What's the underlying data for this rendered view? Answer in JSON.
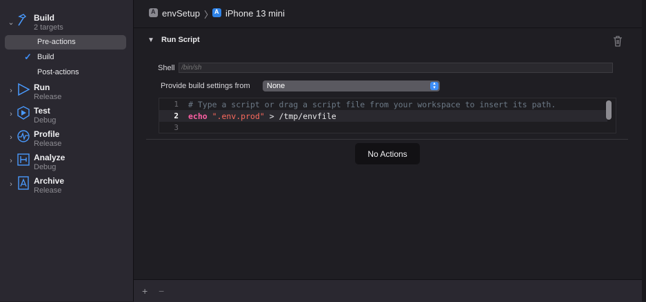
{
  "sidebar": {
    "schemes": [
      {
        "title": "Build",
        "subtitle": "2 targets",
        "icon": "hammer-icon",
        "expanded": true
      },
      {
        "title": "Run",
        "subtitle": "Release",
        "icon": "play-icon"
      },
      {
        "title": "Test",
        "subtitle": "Debug",
        "icon": "test-icon"
      },
      {
        "title": "Profile",
        "subtitle": "Release",
        "icon": "profile-gauge-icon"
      },
      {
        "title": "Analyze",
        "subtitle": "Debug",
        "icon": "analyze-icon"
      },
      {
        "title": "Archive",
        "subtitle": "Release",
        "icon": "archive-icon"
      }
    ],
    "build_subitems": [
      {
        "label": "Pre-actions",
        "selected": true
      },
      {
        "label": "Build",
        "checked": true
      },
      {
        "label": "Post-actions"
      }
    ]
  },
  "breadcrumb": {
    "project": "envSetup",
    "separator": "〉",
    "device": "iPhone 13 mini"
  },
  "run_script": {
    "title": "Run Script",
    "shell_label": "Shell",
    "shell_placeholder": "/bin/sh",
    "provide_label": "Provide build settings from",
    "provide_value": "None",
    "lines": [
      {
        "num": "1",
        "comment": "# Type a script or drag a script file from your workspace to insert its path."
      },
      {
        "num": "2",
        "kw": "echo",
        "str": "\".env.prod\"",
        "rest": " > /tmp/envfile"
      },
      {
        "num": "3"
      }
    ]
  },
  "no_actions_label": "No Actions",
  "bottom": {
    "add": "+",
    "remove": "−"
  },
  "colors": {
    "accent": "#3e8ef7",
    "keyword": "#fc5fa3",
    "string": "#fc6a5d",
    "comment": "#6c7986"
  }
}
